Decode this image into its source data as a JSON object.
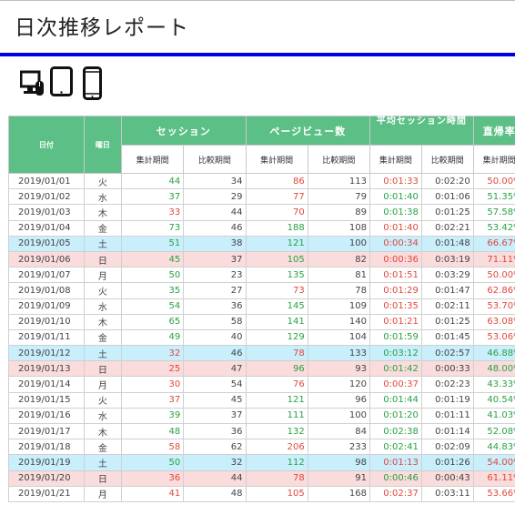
{
  "title": "日次推移レポート",
  "devices": [
    {
      "icon": "desktop-icon"
    },
    {
      "icon": "tablet-icon"
    },
    {
      "icon": "smartphone-icon"
    }
  ],
  "colors": {
    "header_green": "#5cbf86",
    "accent_blue": "#0000e6",
    "good": "#27a243",
    "bad": "#e0483c",
    "saturday": "#c9eefc",
    "sunday": "#fadcdc"
  },
  "table": {
    "date_header": "日付",
    "dow_header": "曜日",
    "groups": [
      "セッション",
      "ページビュー数",
      "平均セッション時間",
      "直帰率"
    ],
    "sub_headers": [
      "集計期間",
      "比較期間"
    ],
    "rows": [
      {
        "date": "2019/01/01",
        "dow": "火",
        "s1": "44",
        "s2": "34",
        "p1": "86",
        "p2": "113",
        "a1": "0:01:33",
        "a2": "0:02:20",
        "b1": "50.00%",
        "type": "",
        "sc": "g",
        "pc": "r",
        "ac": "r",
        "bc": "r"
      },
      {
        "date": "2019/01/02",
        "dow": "水",
        "s1": "37",
        "s2": "29",
        "p1": "77",
        "p2": "79",
        "a1": "0:01:40",
        "a2": "0:01:06",
        "b1": "51.35%",
        "type": "",
        "sc": "g",
        "pc": "r",
        "ac": "g",
        "bc": "g"
      },
      {
        "date": "2019/01/03",
        "dow": "木",
        "s1": "33",
        "s2": "44",
        "p1": "70",
        "p2": "89",
        "a1": "0:01:38",
        "a2": "0:01:25",
        "b1": "57.58%",
        "type": "",
        "sc": "r",
        "pc": "r",
        "ac": "g",
        "bc": "g"
      },
      {
        "date": "2019/01/04",
        "dow": "金",
        "s1": "73",
        "s2": "46",
        "p1": "188",
        "p2": "108",
        "a1": "0:01:40",
        "a2": "0:02:21",
        "b1": "53.42%",
        "type": "",
        "sc": "g",
        "pc": "g",
        "ac": "r",
        "bc": "g"
      },
      {
        "date": "2019/01/05",
        "dow": "土",
        "s1": "51",
        "s2": "38",
        "p1": "121",
        "p2": "100",
        "a1": "0:00:34",
        "a2": "0:01:48",
        "b1": "66.67%",
        "type": "sat",
        "sc": "g",
        "pc": "g",
        "ac": "r",
        "bc": "r"
      },
      {
        "date": "2019/01/06",
        "dow": "日",
        "s1": "45",
        "s2": "37",
        "p1": "105",
        "p2": "82",
        "a1": "0:00:36",
        "a2": "0:03:19",
        "b1": "71.11%",
        "type": "sun",
        "sc": "g",
        "pc": "g",
        "ac": "r",
        "bc": "r"
      },
      {
        "date": "2019/01/07",
        "dow": "月",
        "s1": "50",
        "s2": "23",
        "p1": "135",
        "p2": "81",
        "a1": "0:01:51",
        "a2": "0:03:29",
        "b1": "50.00%",
        "type": "",
        "sc": "g",
        "pc": "g",
        "ac": "r",
        "bc": "r"
      },
      {
        "date": "2019/01/08",
        "dow": "火",
        "s1": "35",
        "s2": "27",
        "p1": "73",
        "p2": "78",
        "a1": "0:01:29",
        "a2": "0:01:47",
        "b1": "62.86%",
        "type": "",
        "sc": "g",
        "pc": "r",
        "ac": "r",
        "bc": "r"
      },
      {
        "date": "2019/01/09",
        "dow": "水",
        "s1": "54",
        "s2": "36",
        "p1": "145",
        "p2": "109",
        "a1": "0:01:35",
        "a2": "0:02:11",
        "b1": "53.70%",
        "type": "",
        "sc": "g",
        "pc": "g",
        "ac": "r",
        "bc": "r"
      },
      {
        "date": "2019/01/10",
        "dow": "木",
        "s1": "65",
        "s2": "58",
        "p1": "141",
        "p2": "140",
        "a1": "0:01:21",
        "a2": "0:01:25",
        "b1": "63.08%",
        "type": "",
        "sc": "g",
        "pc": "g",
        "ac": "r",
        "bc": "r"
      },
      {
        "date": "2019/01/11",
        "dow": "金",
        "s1": "49",
        "s2": "40",
        "p1": "129",
        "p2": "104",
        "a1": "0:01:59",
        "a2": "0:01:45",
        "b1": "53.06%",
        "type": "",
        "sc": "g",
        "pc": "g",
        "ac": "g",
        "bc": "r"
      },
      {
        "date": "2019/01/12",
        "dow": "土",
        "s1": "32",
        "s2": "46",
        "p1": "78",
        "p2": "133",
        "a1": "0:03:12",
        "a2": "0:02:57",
        "b1": "46.88%",
        "type": "sat",
        "sc": "r",
        "pc": "r",
        "ac": "g",
        "bc": "g"
      },
      {
        "date": "2019/01/13",
        "dow": "日",
        "s1": "25",
        "s2": "47",
        "p1": "96",
        "p2": "93",
        "a1": "0:01:42",
        "a2": "0:00:33",
        "b1": "48.00%",
        "type": "sun",
        "sc": "r",
        "pc": "g",
        "ac": "g",
        "bc": "g"
      },
      {
        "date": "2019/01/14",
        "dow": "月",
        "s1": "30",
        "s2": "54",
        "p1": "76",
        "p2": "120",
        "a1": "0:00:37",
        "a2": "0:02:23",
        "b1": "43.33%",
        "type": "",
        "sc": "r",
        "pc": "r",
        "ac": "r",
        "bc": "g"
      },
      {
        "date": "2019/01/15",
        "dow": "火",
        "s1": "37",
        "s2": "45",
        "p1": "121",
        "p2": "96",
        "a1": "0:01:44",
        "a2": "0:01:19",
        "b1": "40.54%",
        "type": "",
        "sc": "r",
        "pc": "g",
        "ac": "g",
        "bc": "g"
      },
      {
        "date": "2019/01/16",
        "dow": "水",
        "s1": "39",
        "s2": "37",
        "p1": "111",
        "p2": "100",
        "a1": "0:01:20",
        "a2": "0:01:11",
        "b1": "41.03%",
        "type": "",
        "sc": "g",
        "pc": "g",
        "ac": "g",
        "bc": "g"
      },
      {
        "date": "2019/01/17",
        "dow": "木",
        "s1": "48",
        "s2": "36",
        "p1": "132",
        "p2": "84",
        "a1": "0:02:38",
        "a2": "0:01:14",
        "b1": "52.08%",
        "type": "",
        "sc": "g",
        "pc": "g",
        "ac": "g",
        "bc": "g"
      },
      {
        "date": "2019/01/18",
        "dow": "金",
        "s1": "58",
        "s2": "62",
        "p1": "206",
        "p2": "233",
        "a1": "0:02:41",
        "a2": "0:02:09",
        "b1": "44.83%",
        "type": "",
        "sc": "r",
        "pc": "r",
        "ac": "g",
        "bc": "g"
      },
      {
        "date": "2019/01/19",
        "dow": "土",
        "s1": "50",
        "s2": "32",
        "p1": "112",
        "p2": "98",
        "a1": "0:01:13",
        "a2": "0:01:26",
        "b1": "54.00%",
        "type": "sat",
        "sc": "g",
        "pc": "g",
        "ac": "r",
        "bc": "r"
      },
      {
        "date": "2019/01/20",
        "dow": "日",
        "s1": "36",
        "s2": "44",
        "p1": "78",
        "p2": "91",
        "a1": "0:00:46",
        "a2": "0:00:43",
        "b1": "61.11%",
        "type": "sun",
        "sc": "r",
        "pc": "r",
        "ac": "g",
        "bc": "r"
      },
      {
        "date": "2019/01/21",
        "dow": "月",
        "s1": "41",
        "s2": "48",
        "p1": "105",
        "p2": "168",
        "a1": "0:02:37",
        "a2": "0:03:11",
        "b1": "53.66%",
        "type": "",
        "sc": "r",
        "pc": "r",
        "ac": "r",
        "bc": "r"
      }
    ]
  }
}
